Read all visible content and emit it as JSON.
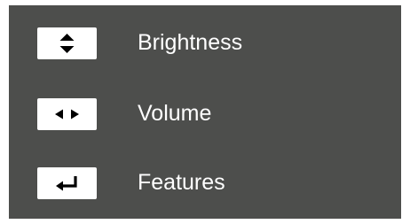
{
  "menu": {
    "items": [
      {
        "label": "Brightness",
        "key_icon": "up-down-arrows-icon"
      },
      {
        "label": "Volume",
        "key_icon": "left-right-arrows-icon"
      },
      {
        "label": "Features",
        "key_icon": "enter-return-icon"
      }
    ]
  },
  "colors": {
    "panel_background": "#4d4e4c",
    "key_background": "#ffffff",
    "icon": "#000000",
    "text": "#ffffff"
  }
}
